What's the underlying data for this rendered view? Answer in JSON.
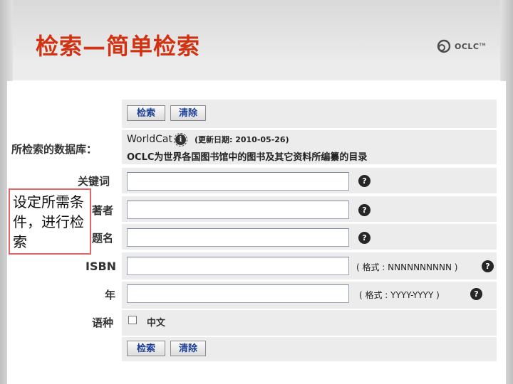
{
  "slide": {
    "title": "检索—简单检索"
  },
  "logo": {
    "text": "OCLC",
    "tm": "TM"
  },
  "form": {
    "search_button": "检索",
    "clear_button": "清除",
    "database": {
      "label": "所检索的数据库：",
      "name": "WorldCat",
      "info_icon": "i",
      "updated": "(更新日期: 2010-05-26)",
      "description": "OCLC为世界各国图书馆中的图书及其它资料所编纂的目录"
    },
    "fields": {
      "keyword": {
        "label": "关键词",
        "value": ""
      },
      "author": {
        "label": "著者",
        "value": ""
      },
      "title": {
        "label": "题名",
        "value": ""
      },
      "isbn": {
        "label": "ISBN",
        "value": "",
        "format": "( 格式 : NNNNNNNNNN )"
      },
      "year": {
        "label": "年",
        "value": "",
        "format": "( 格式 : YYYY-YYYY )"
      },
      "language": {
        "label": "语种",
        "option": "中文",
        "checked": false
      }
    },
    "help_glyph": "?"
  },
  "annotation": {
    "text": "设定所需条件，进行检索"
  },
  "colors": {
    "title": "#d13212",
    "button_text": "#1c3f97",
    "annotation_border": "#e06666"
  },
  "icons": {
    "help": "question-circle-icon",
    "info": "info-icon",
    "logo": "oclc-logo-icon"
  }
}
